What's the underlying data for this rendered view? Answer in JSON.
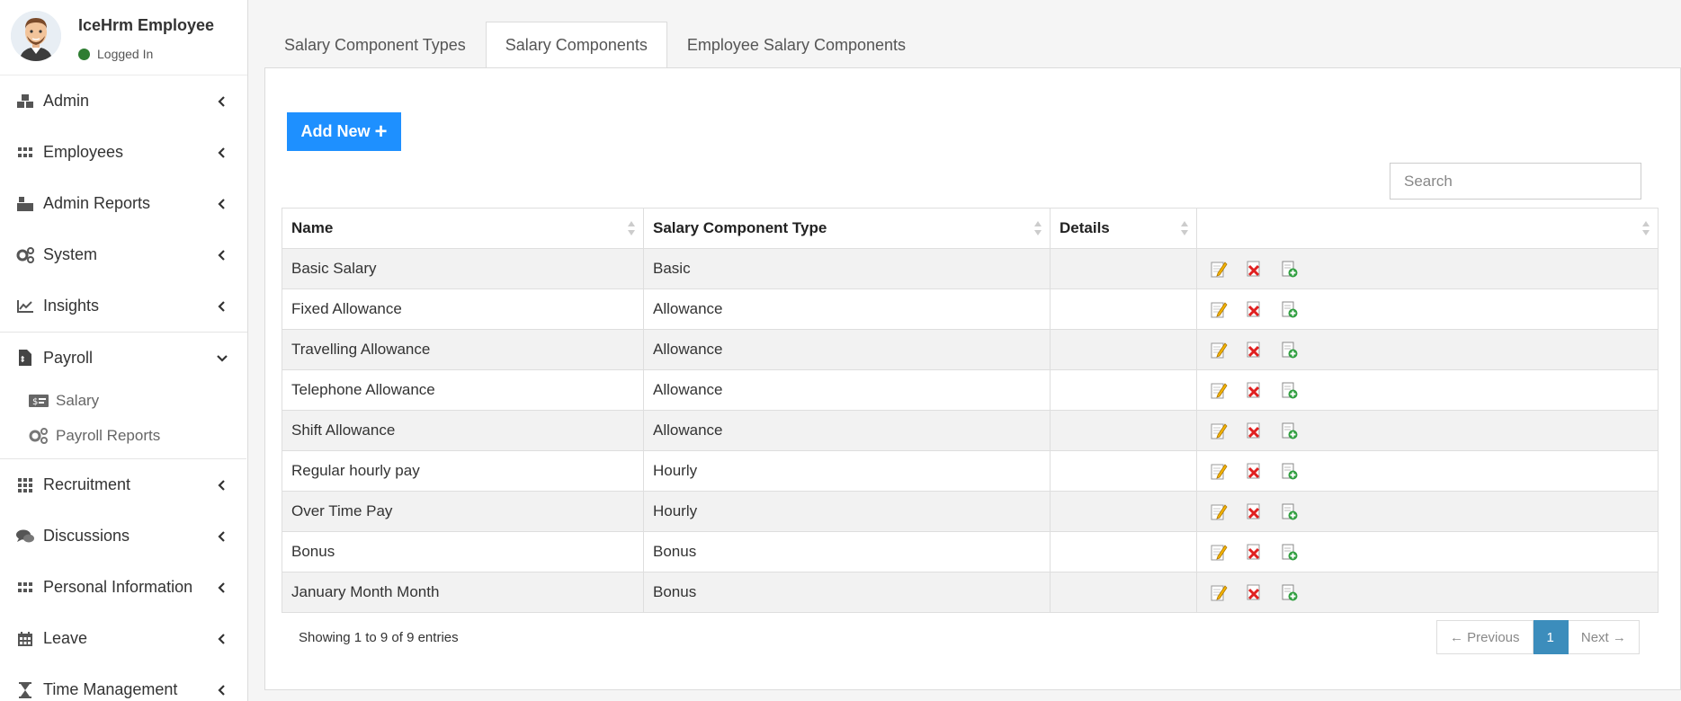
{
  "user": {
    "name": "IceHrm Employee",
    "status": "Logged In"
  },
  "sidebar": {
    "items": [
      {
        "label": "Admin",
        "icon": "cubes-icon"
      },
      {
        "label": "Employees",
        "icon": "grid-icon"
      },
      {
        "label": "Admin Reports",
        "icon": "cubes-icon"
      },
      {
        "label": "System",
        "icon": "gears-icon"
      },
      {
        "label": "Insights",
        "icon": "line-chart-icon"
      }
    ],
    "payroll": {
      "label": "Payroll",
      "icon": "file-icon",
      "sub": [
        {
          "label": "Salary",
          "icon": "money-icon"
        },
        {
          "label": "Payroll Reports",
          "icon": "gears-icon"
        }
      ]
    },
    "items_after": [
      {
        "label": "Recruitment",
        "icon": "grid-icon"
      },
      {
        "label": "Discussions",
        "icon": "comments-icon"
      },
      {
        "label": "Personal Information",
        "icon": "grid-icon"
      },
      {
        "label": "Leave",
        "icon": "calendar-icon"
      },
      {
        "label": "Time Management",
        "icon": "hourglass-icon"
      }
    ]
  },
  "tabs": [
    "Salary Component Types",
    "Salary Components",
    "Employee Salary Components"
  ],
  "active_tab": "Salary Components",
  "toolbar": {
    "add_label": "Add New",
    "search_placeholder": "Search"
  },
  "table": {
    "headers": [
      "Name",
      "Salary Component Type",
      "Details",
      ""
    ],
    "rows": [
      {
        "name": "Basic Salary",
        "type": "Basic",
        "details": ""
      },
      {
        "name": "Fixed Allowance",
        "type": "Allowance",
        "details": ""
      },
      {
        "name": "Travelling Allowance",
        "type": "Allowance",
        "details": ""
      },
      {
        "name": "Telephone Allowance",
        "type": "Allowance",
        "details": ""
      },
      {
        "name": "Shift Allowance",
        "type": "Allowance",
        "details": ""
      },
      {
        "name": "Regular hourly pay",
        "type": "Hourly",
        "details": ""
      },
      {
        "name": "Over Time Pay",
        "type": "Hourly",
        "details": ""
      },
      {
        "name": "Bonus",
        "type": "Bonus",
        "details": ""
      },
      {
        "name": "January Month Month",
        "type": "Bonus",
        "details": ""
      }
    ],
    "row_actions": [
      "edit-icon",
      "delete-icon",
      "copy-icon"
    ]
  },
  "pagination": {
    "info": "Showing 1 to 9 of 9 entries",
    "prev": "← Previous",
    "current": "1",
    "next": "Next →"
  },
  "colors": {
    "primary": "#1e90ff",
    "page_active": "#3c8dbc",
    "online": "#2e7d32"
  }
}
